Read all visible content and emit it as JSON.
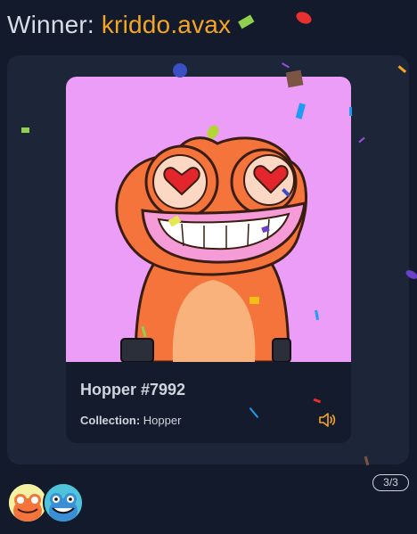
{
  "header": {
    "winner_label": "Winner:",
    "winner_name": "kriddo.avax"
  },
  "card": {
    "image_alt": "Hopper #7992",
    "title": "Hopper #7992",
    "collection_label": "Collection:",
    "collection_value": "Hopper",
    "sound_icon": "speaker-icon"
  },
  "pagination": {
    "text": "3/3"
  },
  "avatars": [
    {
      "name": "avatar-orange-frog"
    },
    {
      "name": "avatar-blue-frog"
    }
  ],
  "colors": {
    "accent": "#f5a524",
    "background": "#121a2c",
    "panel": "#1d2638",
    "nft_background": "#ec9df8"
  }
}
